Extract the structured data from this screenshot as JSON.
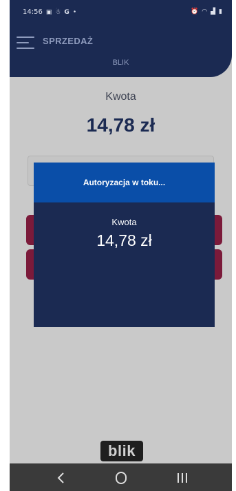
{
  "status_bar": {
    "time": "14:56",
    "left_icons": [
      "gallery-icon",
      "person-icon",
      "google-icon",
      "dot-icon"
    ],
    "right_icons": [
      "alarm-icon",
      "wifi-icon",
      "signal-icon",
      "battery-icon"
    ]
  },
  "header": {
    "title": "SPRZEDAŻ",
    "subtitle": "BLIK"
  },
  "background": {
    "amount_label": "Kwota",
    "amount_value": "14,78 zł"
  },
  "modal": {
    "title": "Autoryzacja w toku...",
    "amount_label": "Kwota",
    "amount_value": "14,78 zł"
  },
  "logo": {
    "text": "blik"
  },
  "colors": {
    "primary_navy": "#1b2a52",
    "modal_header_blue": "#0a4ea8",
    "accent_maroon": "#7b1a3a"
  }
}
